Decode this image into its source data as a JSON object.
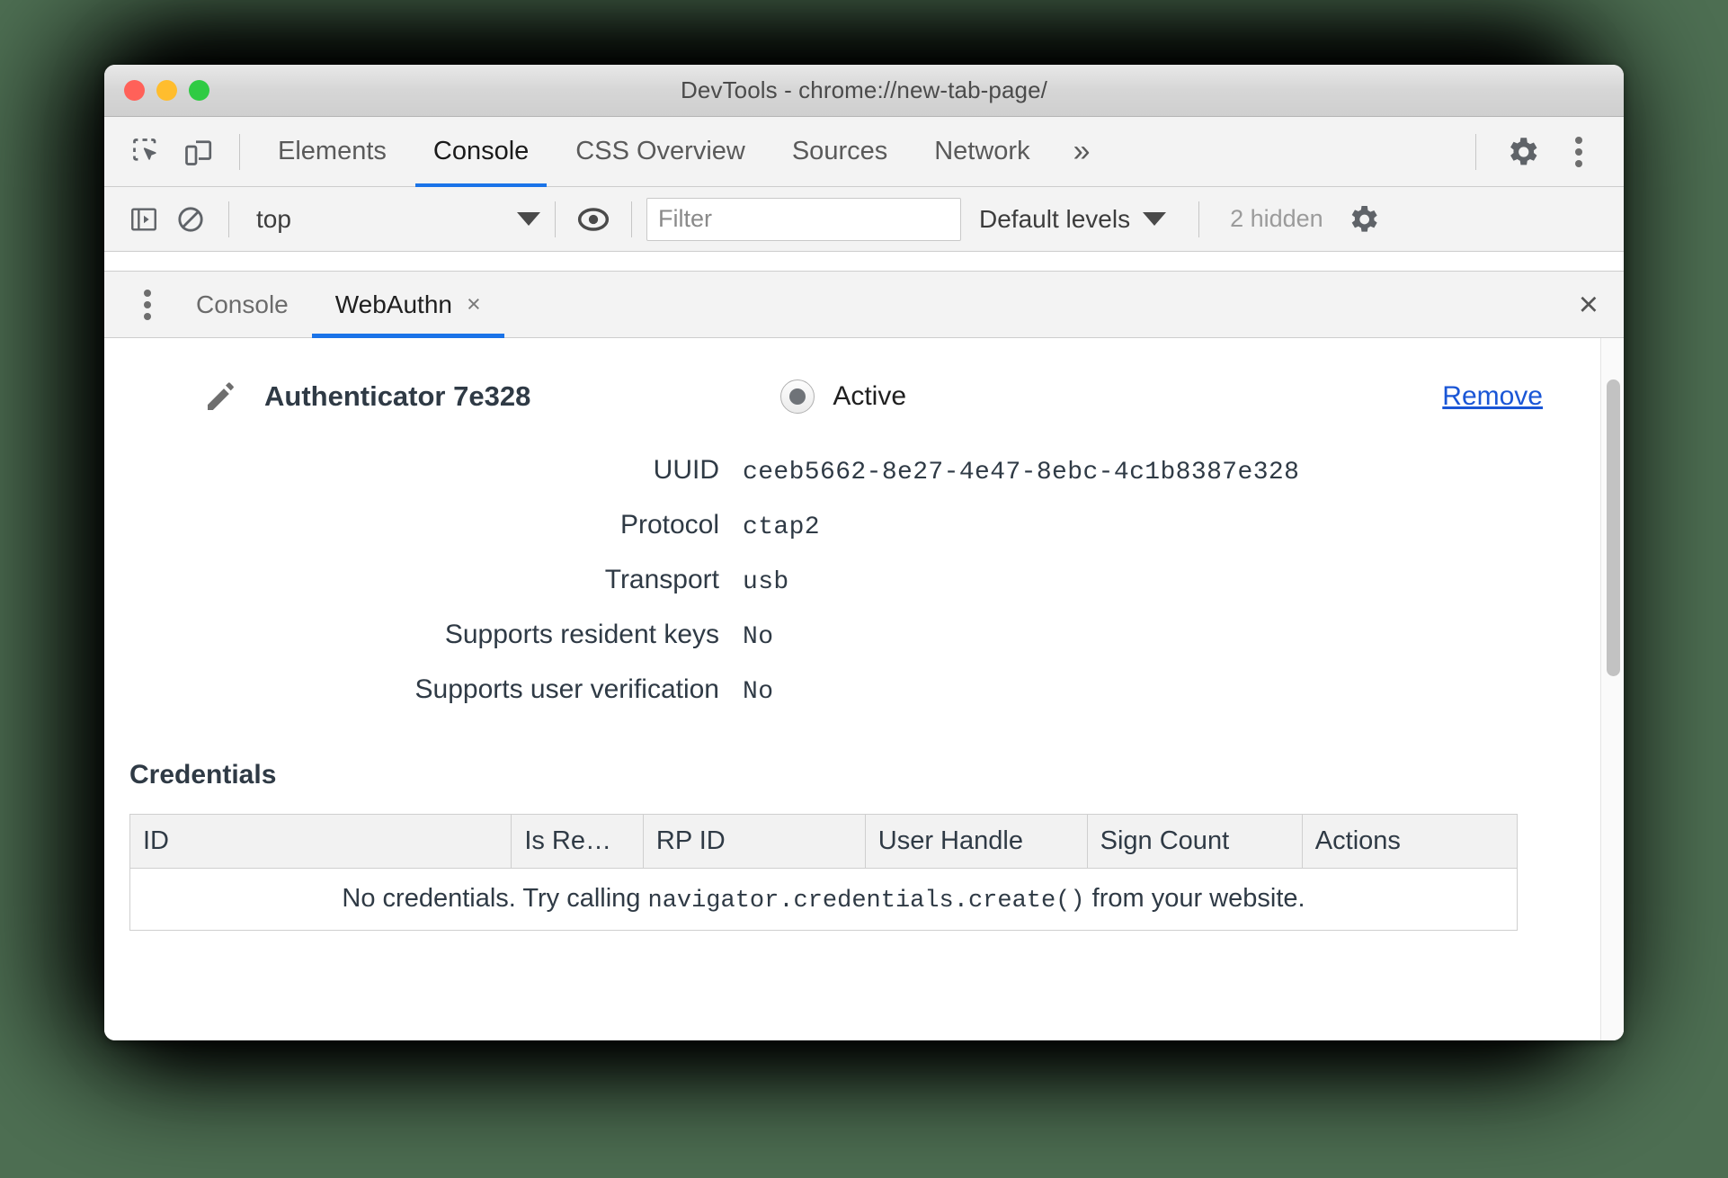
{
  "window": {
    "title": "DevTools - chrome://new-tab-page/",
    "traffic_lights": [
      "close",
      "minimize",
      "maximize"
    ]
  },
  "main_toolbar": {
    "icons": [
      "inspect-element-icon",
      "device-toolbar-icon"
    ],
    "tabs": [
      {
        "label": "Elements",
        "active": false
      },
      {
        "label": "Console",
        "active": true
      },
      {
        "label": "CSS Overview",
        "active": false
      },
      {
        "label": "Sources",
        "active": false
      },
      {
        "label": "Network",
        "active": false
      }
    ],
    "more_tabs": "»",
    "settings_icon": "gear-icon",
    "menu_icon": "kebab-menu-icon"
  },
  "console_toolbar": {
    "sidebar_toggle_icon": "show-console-sidebar-icon",
    "clear_icon": "clear-console-icon",
    "context": {
      "value": "top"
    },
    "eye_icon": "live-expression-icon",
    "filter": {
      "value": "",
      "placeholder": "Filter"
    },
    "levels": {
      "label": "Default levels"
    },
    "hidden": "2 hidden",
    "settings_icon": "console-settings-gear-icon"
  },
  "drawer": {
    "menu_icon": "drawer-kebab-menu-icon",
    "tabs": [
      {
        "label": "Console",
        "active": false,
        "closable": false
      },
      {
        "label": "WebAuthn",
        "active": true,
        "closable": true
      }
    ],
    "tab_close_glyph": "×",
    "close_glyph": "×"
  },
  "webauthn": {
    "edit_icon": "pencil-edit-icon",
    "authenticator_name": "Authenticator 7e328",
    "active_label": "Active",
    "active_selected": true,
    "remove_label": "Remove",
    "fields": [
      {
        "label": "UUID",
        "value": "ceeb5662-8e27-4e47-8ebc-4c1b8387e328"
      },
      {
        "label": "Protocol",
        "value": "ctap2"
      },
      {
        "label": "Transport",
        "value": "usb"
      },
      {
        "label": "Supports resident keys",
        "value": "No"
      },
      {
        "label": "Supports user verification",
        "value": "No"
      }
    ],
    "credentials": {
      "heading": "Credentials",
      "columns": [
        "ID",
        "Is Re…",
        "RP ID",
        "User Handle",
        "Sign Count",
        "Actions"
      ],
      "rows": [],
      "empty_message_prefix": "No credentials. Try calling ",
      "empty_message_code": "navigator.credentials.create()",
      "empty_message_suffix": " from your website."
    }
  },
  "colors": {
    "accent": "#1a73e8",
    "link": "#1a56d6",
    "page_background": "#4d6e52",
    "text": "#2f3a45"
  }
}
